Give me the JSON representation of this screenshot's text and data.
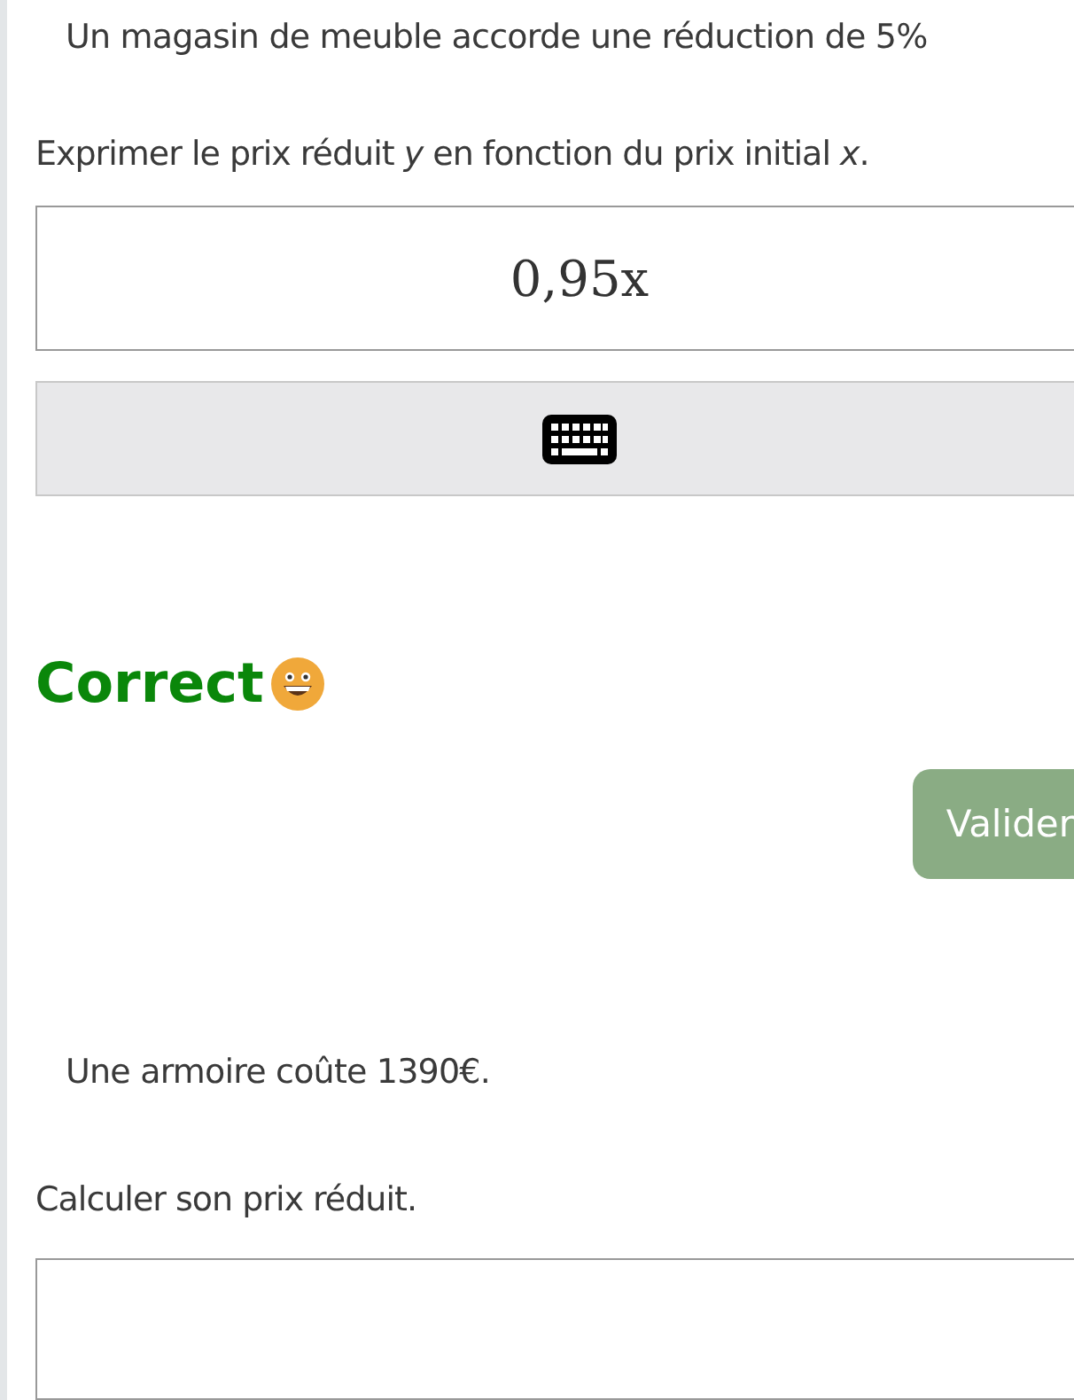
{
  "question": {
    "statement": "Un magasin de meuble accorde une réduction de 5%",
    "prompt": "Exprimer le prix réduit *y* en fonction du prix initial *x*.",
    "answer": {
      "value": "0,95x"
    },
    "feedback": {
      "text": "Correct",
      "correct": true
    },
    "submit_button": "Valider"
  },
  "next": {
    "statement": "Une armoire coûte 1390€.",
    "prompt": "Calculer son prix réduit."
  }
}
